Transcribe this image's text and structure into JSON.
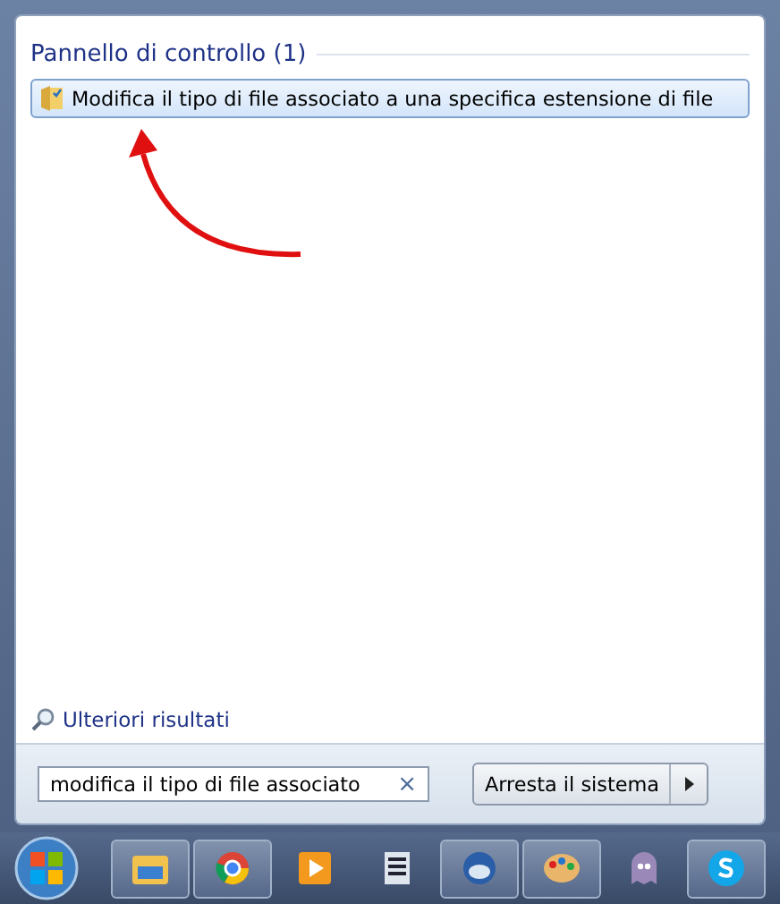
{
  "section": {
    "title": "Pannello di controllo (1)"
  },
  "results": [
    {
      "label": "Modifica il tipo di file associato a una specifica estensione di file",
      "selected": true
    }
  ],
  "more_results": "Ulteriori risultati",
  "search": {
    "value": "modifica il tipo di file associato",
    "clear": "×"
  },
  "shutdown": {
    "label": "Arresta il sistema"
  },
  "taskbar": [
    {
      "kind": "folder",
      "running": true
    },
    {
      "kind": "browser",
      "running": true
    },
    {
      "kind": "play",
      "running": false
    },
    {
      "kind": "document",
      "running": false
    },
    {
      "kind": "bird",
      "running": true
    },
    {
      "kind": "paint",
      "running": true
    },
    {
      "kind": "ghost",
      "running": false
    },
    {
      "kind": "chat",
      "running": true
    }
  ]
}
